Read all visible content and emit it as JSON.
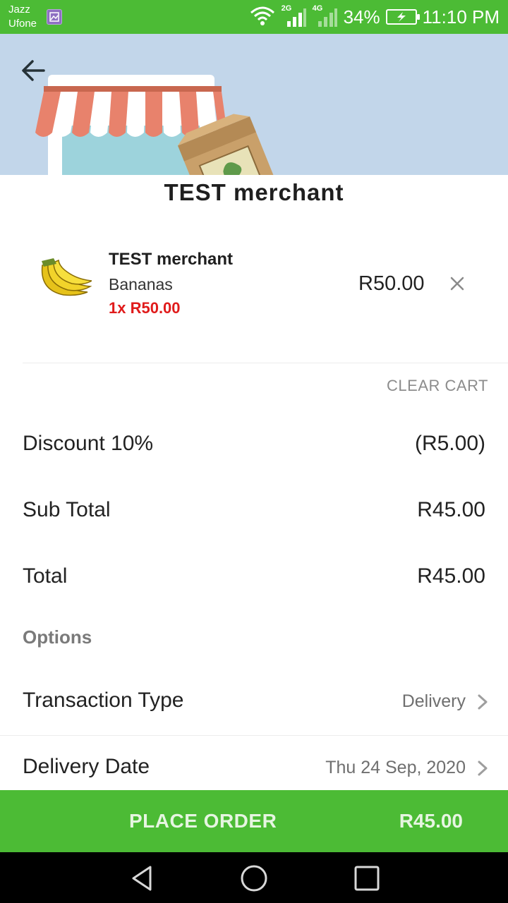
{
  "status_bar": {
    "carrier_1": "Jazz",
    "carrier_2": "Ufone",
    "net_1": "2G",
    "net_2": "4G",
    "battery": "34%",
    "time": "11:10 PM"
  },
  "merchant_title": "TEST merchant",
  "cart_item": {
    "merchant": "TEST merchant",
    "name": "Bananas",
    "qty_price": "1x R50.00",
    "price": "R50.00"
  },
  "clear_cart": "CLEAR CART",
  "summary": {
    "discount_label": "Discount  10%",
    "discount_value": "(R5.00)",
    "subtotal_label": "Sub Total",
    "subtotal_value": "R45.00",
    "total_label": "Total",
    "total_value": "R45.00"
  },
  "options": {
    "title": "Options",
    "transaction_type_label": "Transaction Type",
    "transaction_type_value": "Delivery",
    "delivery_date_label": "Delivery Date",
    "delivery_date_value": "Thu 24 Sep, 2020"
  },
  "place_order": {
    "label": "PLACE ORDER",
    "total": "R45.00"
  },
  "colors": {
    "brand_green": "#4cbb35",
    "qty_red": "#e01b1b",
    "banner_blue": "#c2d6ea"
  },
  "icons": [
    "wifi-icon",
    "signal-icon",
    "battery-charging-icon",
    "back-arrow-icon",
    "close-icon",
    "chevron-right-icon",
    "nav-back-icon",
    "nav-home-icon",
    "nav-recents-icon"
  ]
}
